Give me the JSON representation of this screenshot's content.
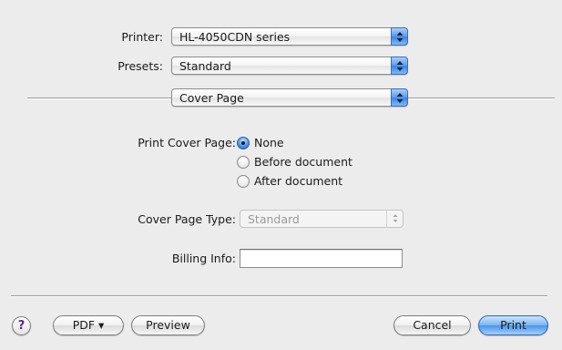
{
  "printer": {
    "label": "Printer:",
    "value": "HL-4050CDN series"
  },
  "presets": {
    "label": "Presets:",
    "value": "Standard"
  },
  "section": {
    "value": "Cover Page"
  },
  "cover_page": {
    "label": "Print Cover Page:",
    "options": [
      "None",
      "Before document",
      "After document"
    ],
    "selected": "None"
  },
  "cover_page_type": {
    "label": "Cover Page Type:",
    "value": "Standard",
    "enabled": false
  },
  "billing_info": {
    "label": "Billing Info:",
    "value": ""
  },
  "buttons": {
    "help": "?",
    "pdf": "PDF ▾",
    "preview": "Preview",
    "cancel": "Cancel",
    "print": "Print"
  },
  "icons": {
    "popup_arrows": "up-down-arrows-icon",
    "radio_selected": "radio-selected-icon"
  }
}
